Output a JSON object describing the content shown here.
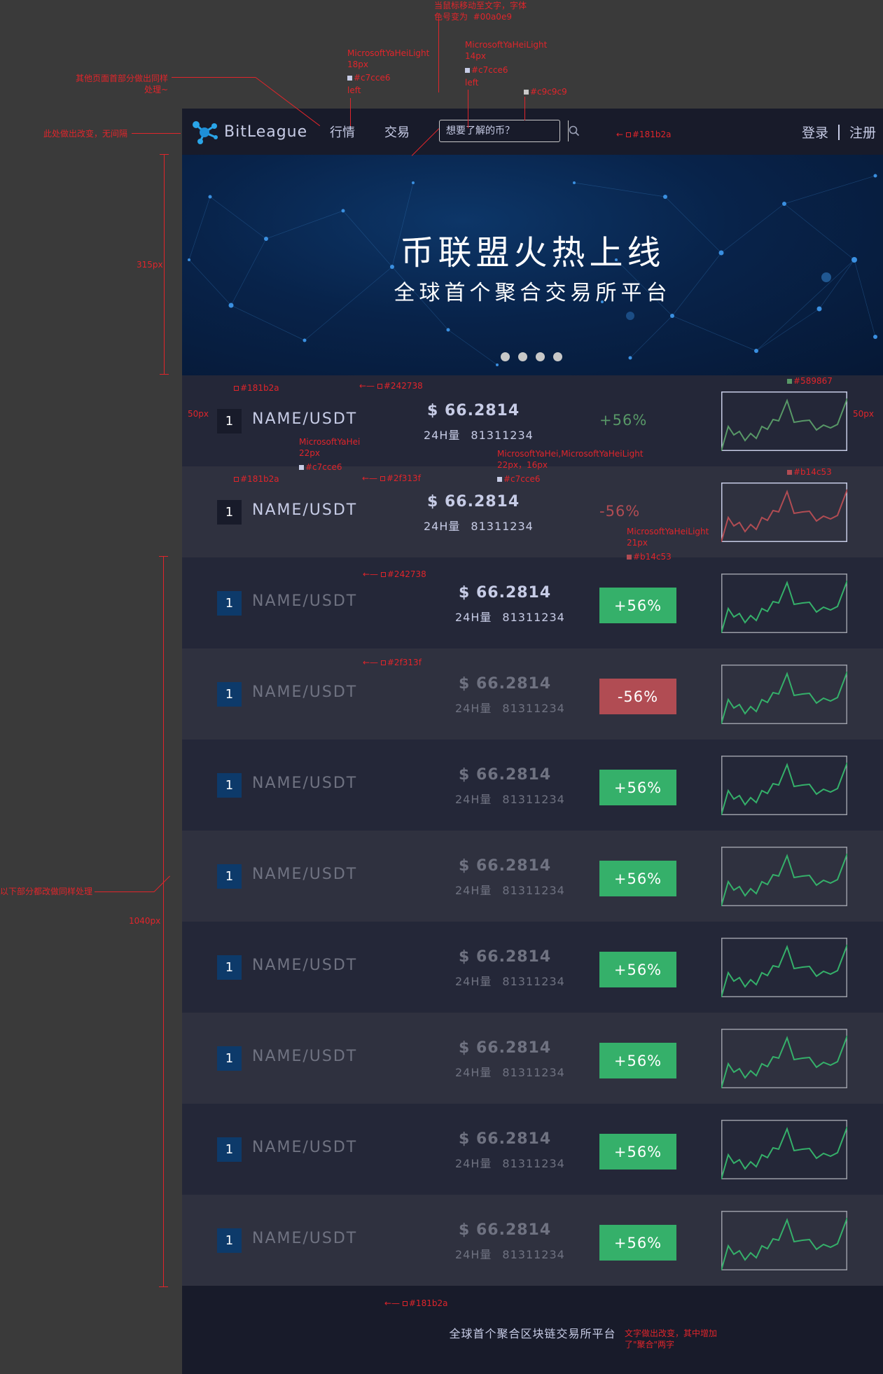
{
  "header": {
    "logo_text": "BitLeague",
    "nav": [
      "行情",
      "交易"
    ],
    "search_placeholder": "想要了解的币？",
    "login": "登录",
    "register": "注册"
  },
  "banner": {
    "title": "币联盟火热上线",
    "subtitle": "全球首个聚合交易所平台",
    "slides": 4
  },
  "rows": [
    {
      "rank": "1",
      "pair": "NAME/USDT",
      "price": "$ 66.2814",
      "vol_label": "24H量",
      "vol": "81311234",
      "change": "+56%",
      "dir": "up",
      "style": "text"
    },
    {
      "rank": "1",
      "pair": "NAME/USDT",
      "price": "$ 66.2814",
      "vol_label": "24H量",
      "vol": "81311234",
      "change": "-56%",
      "dir": "down",
      "style": "text"
    },
    {
      "rank": "1",
      "pair": "NAME/USDT",
      "price": "$ 66.2814",
      "vol_label": "24H量",
      "vol": "81311234",
      "change": "+56%",
      "dir": "up",
      "style": "box"
    },
    {
      "rank": "1",
      "pair": "NAME/USDT",
      "price": "$ 66.2814",
      "vol_label": "24H量",
      "vol": "81311234",
      "change": "-56%",
      "dir": "down",
      "style": "box"
    },
    {
      "rank": "1",
      "pair": "NAME/USDT",
      "price": "$ 66.2814",
      "vol_label": "24H量",
      "vol": "81311234",
      "change": "+56%",
      "dir": "up",
      "style": "box"
    },
    {
      "rank": "1",
      "pair": "NAME/USDT",
      "price": "$ 66.2814",
      "vol_label": "24H量",
      "vol": "81311234",
      "change": "+56%",
      "dir": "up",
      "style": "box"
    },
    {
      "rank": "1",
      "pair": "NAME/USDT",
      "price": "$ 66.2814",
      "vol_label": "24H量",
      "vol": "81311234",
      "change": "+56%",
      "dir": "up",
      "style": "box"
    },
    {
      "rank": "1",
      "pair": "NAME/USDT",
      "price": "$ 66.2814",
      "vol_label": "24H量",
      "vol": "81311234",
      "change": "+56%",
      "dir": "up",
      "style": "box"
    },
    {
      "rank": "1",
      "pair": "NAME/USDT",
      "price": "$ 66.2814",
      "vol_label": "24H量",
      "vol": "81311234",
      "change": "+56%",
      "dir": "up",
      "style": "box"
    },
    {
      "rank": "1",
      "pair": "NAME/USDT",
      "price": "$ 66.2814",
      "vol_label": "24H量",
      "vol": "81311234",
      "change": "+56%",
      "dir": "up",
      "style": "box"
    }
  ],
  "footer": {
    "text": "全球首个聚合区块链交易所平台"
  },
  "colors": {
    "bg_dark": "#181b2a",
    "row_a": "#242738",
    "row_b": "#2f313f",
    "text_main": "#c7cce6",
    "up": "#589867",
    "down": "#b14c53",
    "up_box": "#35b06a",
    "down_box": "#b14c53",
    "rank_blue": "#0d3a6a",
    "annotation": "#e0252b"
  },
  "annotations": {
    "a_hover": "当鼠标移动至文字，字体\n色号变为  #00a0e9",
    "a_nav_font": "MicrosoftYaHeiLight\n18px",
    "a_nav_color": "#c7cce6",
    "a_nav_align": "left",
    "a_search_font": "MicrosoftYaHeiLight\n14px",
    "a_search_color": "#c7cce6",
    "a_search_align": "left",
    "a_border": "#c9c9c9",
    "a_other_pages": "其他页面首部分做出同样\n处理~",
    "a_no_gap": "此处做出改变，无间隔",
    "a_topbar": "#181b2a",
    "a_315": "315px",
    "a_row1_rank": "#181b2a",
    "a_row1_bg": "#242738",
    "a_sparkup": "#589867",
    "a_50l": "50px",
    "a_50r": "50px",
    "a_pair_font": "MicrosoftYaHei\n22px",
    "a_pair_color": "#c7cce6",
    "a_price_font": "MicrosoftYaHei,MicrosoftYaHeiLight\n22px，16px",
    "a_price_color": "#c7cce6",
    "a_row2_rank": "#181b2a",
    "a_row2_bg": "#2f313f",
    "a_sparkdown": "#b14c53",
    "a_chg_font": "MicrosoftYaHeiLight\n21px",
    "a_chg_color": "#b14c53",
    "a_row3_bg": "#242738",
    "a_row4_bg": "#2f313f",
    "a_below": "以下部分都改做同样处理",
    "a_1040": "1040px",
    "a_footer_bg": "#181b2a",
    "a_footer_note": "文字做出改变，其中增加\n了\"聚合\"两字"
  }
}
